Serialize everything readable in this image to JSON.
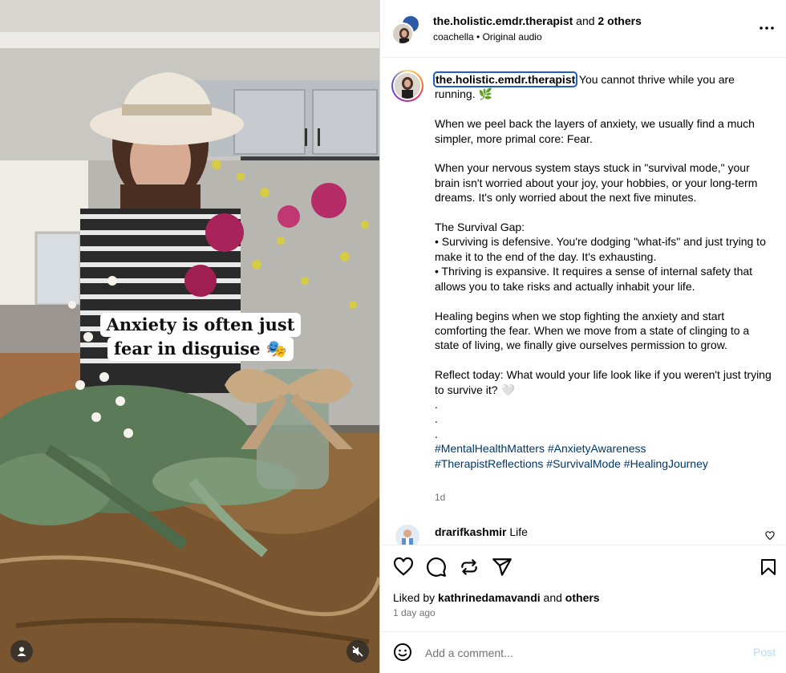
{
  "media": {
    "overlay_line1": "Anxiety is often just",
    "overlay_line2": "fear in disguise 🎭"
  },
  "header": {
    "username": "the.holistic.emdr.therapist",
    "and_text": "and",
    "others": "2 others",
    "audio_source": "coachella",
    "separator": "•",
    "audio_label": "Original audio",
    "more_icon": "⋯"
  },
  "caption": {
    "username": "the.holistic.emdr.therapist",
    "text": " You cannot thrive while you are running. 🌿\n\nWhen we peel back the layers of anxiety, we usually find a much simpler, more primal core: Fear.\n\nWhen your nervous system stays stuck in \"survival mode,\" your brain isn't worried about your joy, your hobbies, or your long-term dreams. It's only worried about the next five minutes.\n\nThe Survival Gap:\n• Surviving is defensive. You're dodging \"what-ifs\" and just trying to make it to the end of the day. It's exhausting.\n• Thriving is expansive. It requires a sense of internal safety that allows you to take risks and actually inhabit your life.\n\nHealing begins when we stop fighting the anxiety and start comforting the fear. When we move from a state of clinging to a state of living, we finally give ourselves permission to grow.\n\nReflect today: What would your life look like if you weren't just trying to survive it? 🤍\n.\n.\n.\n",
    "hashtags": [
      "#MentalHealthMatters",
      "#AnxietyAwareness",
      "#TherapistReflections",
      "#SurvivalMode",
      "#HealingJourney"
    ],
    "time": "1d"
  },
  "comment": {
    "username": "drarifkashmir",
    "text": "Life"
  },
  "actions": {
    "liked_prefix": "Liked by",
    "liked_user": "kathrinedamavandi",
    "liked_and": "and",
    "liked_others": "others",
    "time_ago": "1 day ago"
  },
  "add_comment": {
    "placeholder": "Add a comment...",
    "post_label": "Post"
  },
  "colors": {
    "link": "#00376b",
    "post_disabled": "#b3dbff",
    "secondary_text": "#737373"
  }
}
